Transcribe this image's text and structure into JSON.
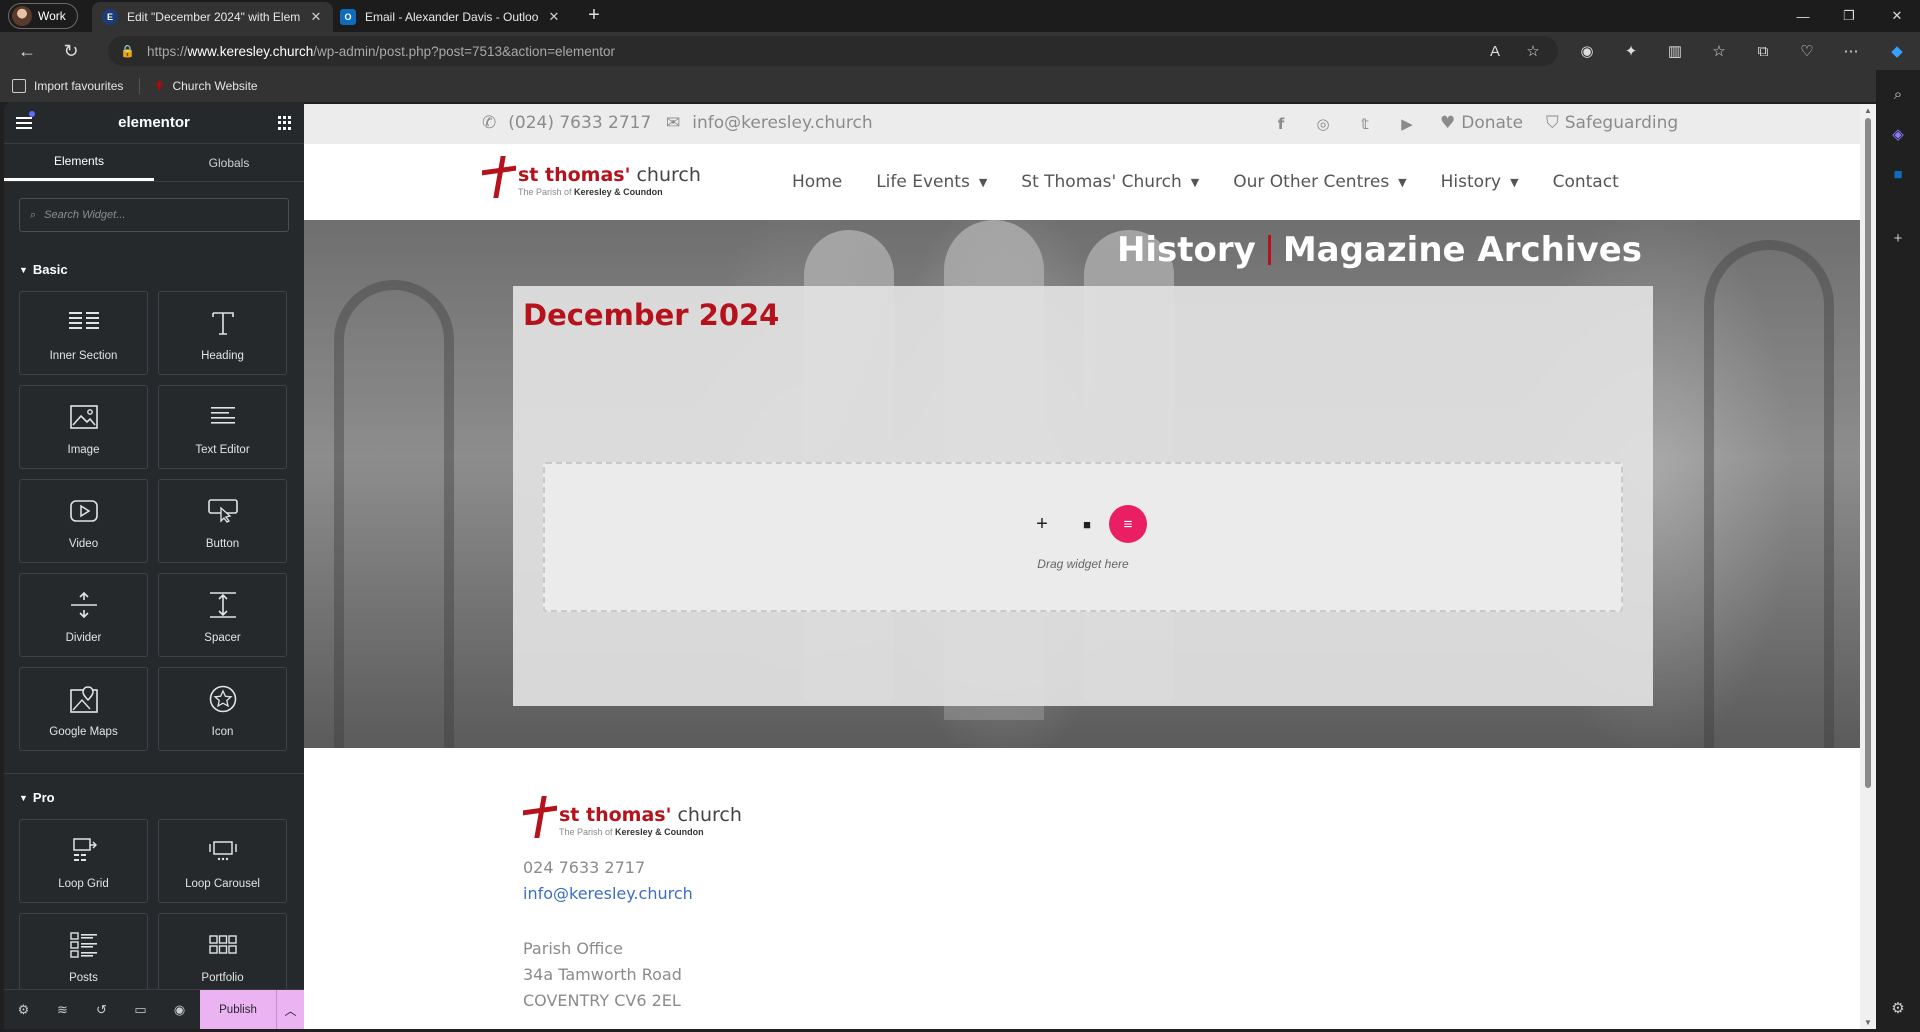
{
  "browser": {
    "profile": "Work",
    "tabs": [
      {
        "title": "Edit \"December 2024\" with Elem",
        "favicon": "elementor-icon",
        "active": true
      },
      {
        "title": "Email - Alexander Davis - Outloo",
        "favicon": "outlook-icon",
        "active": false
      }
    ],
    "url_prefix": "https://",
    "url_domain": "www.keresley.church",
    "url_path": "/wp-admin/post.php?post=7513&action=elementor",
    "favourites": {
      "import": "Import favourites",
      "church": "Church Website"
    }
  },
  "panel": {
    "logo": "elementor",
    "tabs": {
      "elements": "Elements",
      "globals": "Globals"
    },
    "search_placeholder": "Search Widget...",
    "basic": {
      "label": "Basic",
      "widgets": [
        "Inner Section",
        "Heading",
        "Image",
        "Text Editor",
        "Video",
        "Button",
        "Divider",
        "Spacer",
        "Google Maps",
        "Icon"
      ]
    },
    "pro": {
      "label": "Pro",
      "widgets": [
        "Loop Grid",
        "Loop Carousel",
        "Posts",
        "Portfolio"
      ]
    },
    "publish": "Publish"
  },
  "site": {
    "phone": "(024) 7633 2717",
    "email": "info@keresley.church",
    "donate": "Donate",
    "safeguarding": "Safeguarding",
    "brand": {
      "st": "st thomas'",
      "church": "church",
      "parish_prefix": "The Parish of",
      "parish": "Keresley & Coundon"
    },
    "menu": [
      "Home",
      "Life Events",
      "St Thomas' Church",
      "Our Other Centres",
      "History",
      "Contact"
    ],
    "hero": {
      "title_left": "History",
      "title_right": "Magazine Archives"
    },
    "content_heading": "December 2024",
    "drag_text": "Drag widget here",
    "footer": {
      "phone": "024 7633 2717",
      "email": "info@keresley.church",
      "office": "Parish Office",
      "street": "34a Tamworth Road",
      "city": "COVENTRY CV6 2EL"
    }
  }
}
